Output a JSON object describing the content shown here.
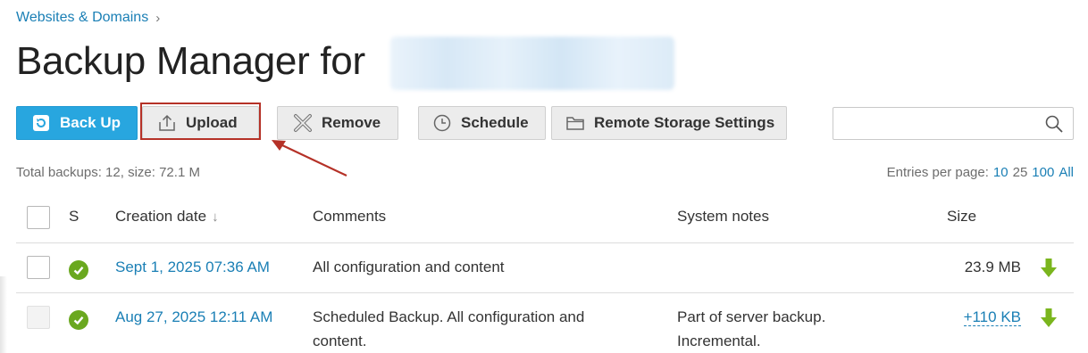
{
  "breadcrumb": {
    "label": "Websites & Domains",
    "chevron": "›"
  },
  "page": {
    "title": "Backup Manager for"
  },
  "toolbar": {
    "backup_label": "Back Up",
    "upload_label": "Upload",
    "remove_label": "Remove",
    "schedule_label": "Schedule",
    "remote_storage_label": "Remote Storage Settings"
  },
  "search": {
    "placeholder": ""
  },
  "summary": {
    "text": "Total backups: 12, size: 72.1 M"
  },
  "entries_per_page": {
    "label": "Entries per page:",
    "options": [
      "10",
      "25",
      "100",
      "All"
    ],
    "selected": "25"
  },
  "table": {
    "columns": {
      "status": "S",
      "creation_date": "Creation date",
      "sort_indicator": "↓",
      "comments": "Comments",
      "system_notes": "System notes",
      "size": "Size"
    },
    "rows": [
      {
        "date": "Sept 1, 2025 07:36 AM",
        "comments": "All configuration and content",
        "comments_line2": "",
        "notes": "",
        "notes_line2": "",
        "size": "23.9 MB"
      },
      {
        "date": "Aug 27, 2025 12:11 AM",
        "comments": "Scheduled Backup. All configuration and",
        "comments_line2": "content.",
        "notes": "Part of server backup.",
        "notes_line2": "Incremental.",
        "size": "+110 KB"
      }
    ]
  },
  "colors": {
    "accent": "#28a6df",
    "link": "#1a7fb5",
    "success": "#6aa81f",
    "annotation": "#b53127"
  }
}
